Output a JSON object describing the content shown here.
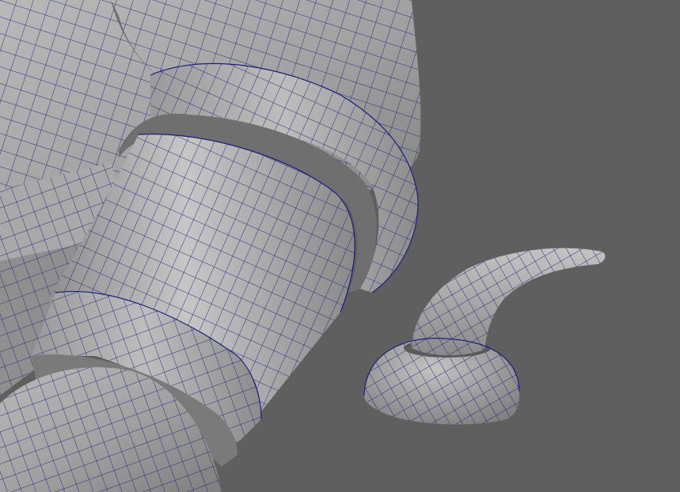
{
  "viewport": {
    "background_color": "#5f5f5f",
    "shaded_color": "#9a9a9a",
    "highlight_color": "#c9c9c9",
    "shadow_color": "#555555",
    "wireframe_color": "#1b1f7a"
  },
  "scene": {
    "objects": [
      {
        "name": "arm-sleeve-body",
        "icon": "mesh-icon"
      },
      {
        "name": "upper-cuff-ring",
        "icon": "mesh-icon"
      },
      {
        "name": "lower-cuff-ring",
        "icon": "mesh-icon"
      },
      {
        "name": "hook-prop",
        "icon": "mesh-icon"
      }
    ]
  }
}
